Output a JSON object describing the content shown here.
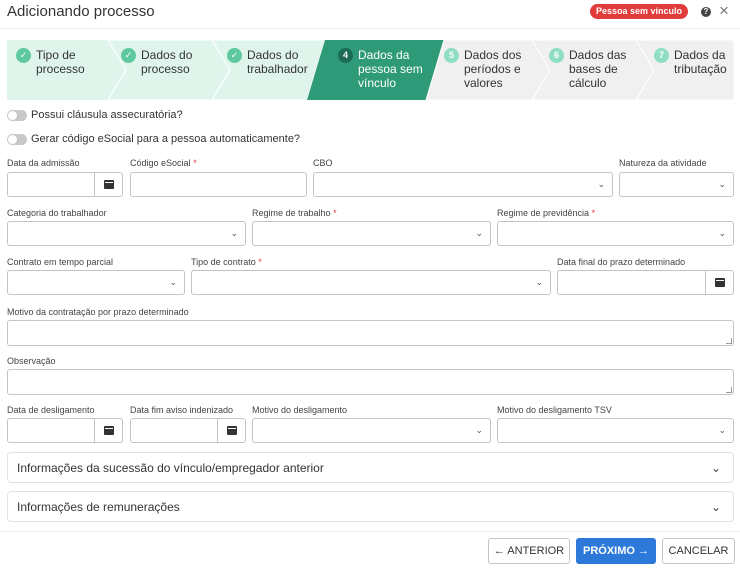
{
  "header": {
    "title": "Adicionando processo",
    "badge": "Pessoa sem vínculo",
    "help_icon": "?",
    "close_icon": "×"
  },
  "stepper": {
    "steps": [
      {
        "number": "✓",
        "label": "Tipo de\nprocesso",
        "state": "done"
      },
      {
        "number": "✓",
        "label": "Dados do\nprocesso",
        "state": "done"
      },
      {
        "number": "✓",
        "label": "Dados do\ntrabalhador",
        "state": "done"
      },
      {
        "number": "4",
        "label": "Dados da\npessoa sem\nvínculo",
        "state": "active"
      },
      {
        "number": "5",
        "label": "Dados dos\nperíodos e\nvalores",
        "state": "pending"
      },
      {
        "number": "6",
        "label": "Dados das\nbases de\ncálculo",
        "state": "pending"
      },
      {
        "number": "7",
        "label": "Dados da\ntributação",
        "state": "pending"
      }
    ]
  },
  "toggles": {
    "clausula": "Possui cláusula assecuratória?",
    "gerar_codigo": "Gerar código eSocial para a pessoa automaticamente?"
  },
  "form": {
    "data_admissao": "Data da admissão",
    "codigo_esocial": "Código eSocial",
    "cbo": "CBO",
    "natureza_atividade": "Natureza da atividade",
    "categoria_trabalhador": "Categoria do trabalhador",
    "regime_trabalho": "Regime de trabalho",
    "regime_previdencia": "Regime de previdência",
    "contrato_tempo_parcial": "Contrato em tempo parcial",
    "tipo_contrato": "Tipo de contrato",
    "data_final_prazo": "Data final do prazo determinado",
    "motivo_contratacao": "Motivo da contratação por prazo determinado",
    "observacao": "Observação",
    "data_desligamento": "Data de desligamento",
    "data_fim_aviso": "Data fim aviso indenizado",
    "motivo_desligamento": "Motivo do desligamento",
    "motivo_desligamento_tsv": "Motivo do desligamento TSV",
    "required_mark": "*"
  },
  "accordions": {
    "sucessao": "Informações da sucessão do vínculo/empregador anterior",
    "remuneracoes": "Informações de remunerações"
  },
  "footer": {
    "anterior": "← ANTERIOR",
    "proximo": "PRÓXIMO →",
    "cancelar": "CANCELAR"
  },
  "colors": {
    "step_done_bg": "#dff5ec",
    "step_active_bg": "#2e9a78",
    "step_pending_bg": "#f0f0f0",
    "badge": "#e03c3c",
    "primary": "#2d79d9"
  }
}
